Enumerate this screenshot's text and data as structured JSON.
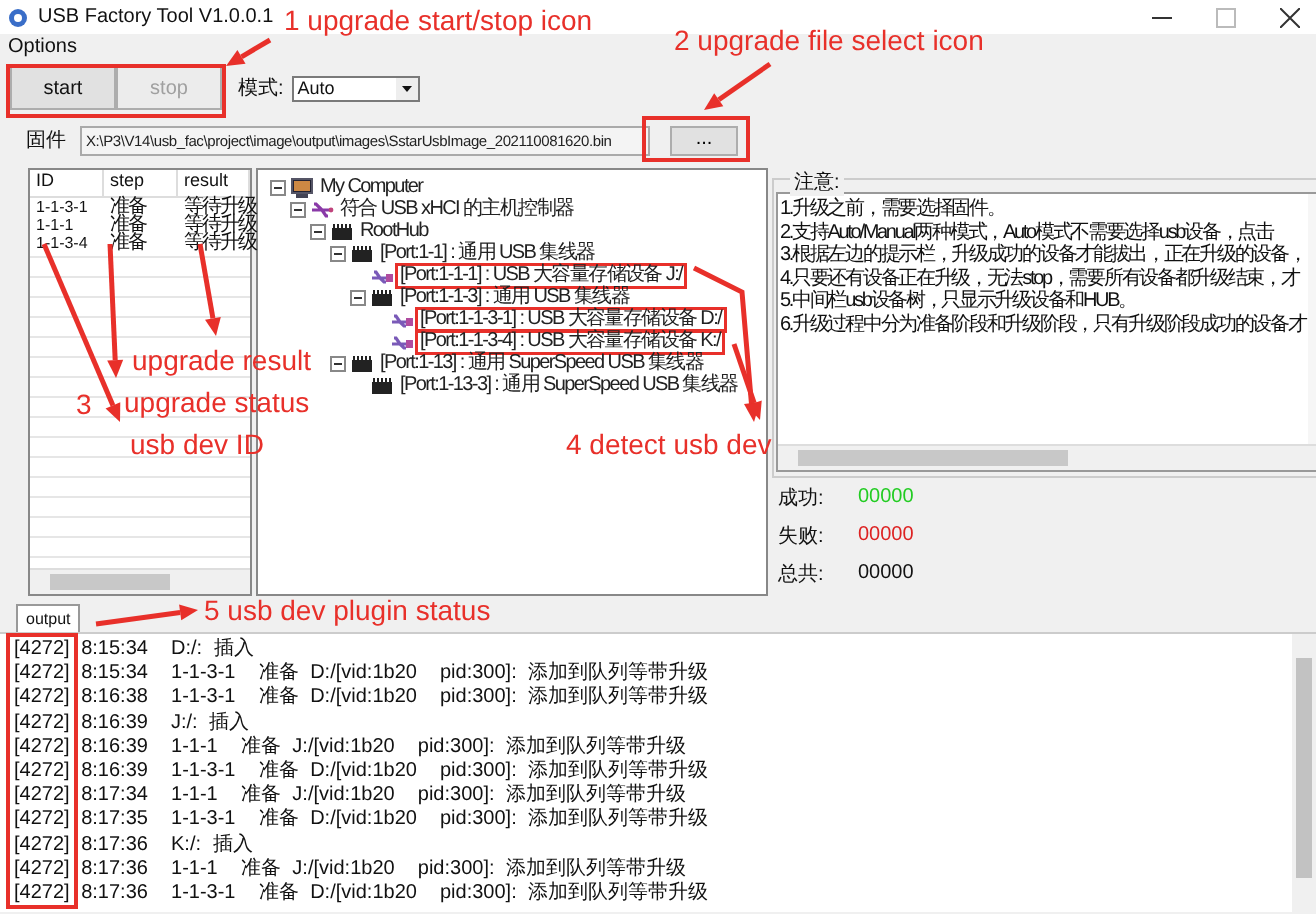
{
  "window": {
    "title": "USB Factory Tool V1.0.0.1"
  },
  "menu": [
    "Options"
  ],
  "buttons": [
    {
      "label": "start",
      "disabled": false
    },
    {
      "label": "stop",
      "disabled": true
    }
  ],
  "mode": {
    "label": "模式:",
    "value": "Auto"
  },
  "firmware": {
    "label": "固件",
    "value": "X:\\P3\\V14\\usb_fac\\project\\image\\output\\images\\SstarUsbImage_202110081620.bin",
    "button": "..."
  },
  "device_list": {
    "columns": [
      "ID",
      "step",
      "result"
    ],
    "rows": [
      [
        "1-1-3-1",
        "准备",
        "等待升级"
      ],
      [
        "1-1-1",
        "准备",
        "等待升级"
      ],
      [
        "1-1-3-4",
        "准备",
        "等待升级"
      ]
    ]
  },
  "tree": [
    {
      "label": "My Computer",
      "kind": "computer",
      "marked": false,
      "expanded": true,
      "children": [
        {
          "label": "符合 USB xHCI 的主机控制器",
          "kind": "controller",
          "marked": false,
          "expanded": true,
          "children": [
            {
              "label": "RootHub",
              "kind": "hub",
              "marked": false,
              "expanded": true,
              "children": [
                {
                  "label": "[Port:1-1] : 通用 USB 集线器",
                  "kind": "hub",
                  "marked": false,
                  "expanded": true,
                  "children": [
                    {
                      "label": "[Port:1-1-1] : USB 大容量存储设备 J:/",
                      "kind": "device",
                      "marked": true
                    },
                    {
                      "label": "[Port:1-1-3] : 通用 USB 集线器",
                      "kind": "hub",
                      "marked": false,
                      "expanded": true,
                      "children": [
                        {
                          "label": "[Port:1-1-3-1] : USB 大容量存储设备 D:/",
                          "kind": "device",
                          "marked": true
                        },
                        {
                          "label": "[Port:1-1-3-4] : USB 大容量存储设备 K:/",
                          "kind": "device",
                          "marked": true
                        }
                      ]
                    }
                  ]
                },
                {
                  "label": "[Port:1-13] : 通用 SuperSpeed USB 集线器",
                  "kind": "hub",
                  "marked": false,
                  "expanded": true,
                  "children": [
                    {
                      "label": "[Port:1-13-3] : 通用 SuperSpeed USB 集线器",
                      "kind": "hub",
                      "marked": false
                    }
                  ]
                }
              ]
            }
          ]
        }
      ]
    }
  ],
  "notes": {
    "title": "注意:",
    "lines": [
      "1.升级之前，需要选择固件。",
      "2.支持Auto/Manual两种模式，Auto模式不需要选择usb设备，点击",
      "3.根据左边的提示栏，升级成功的设备才能拔出，正在升级的设备，",
      "4.只要还有设备正在升级，无法stop，需要所有设备都升级结束，才",
      "5.中间栏usb设备树，只显示升级设备和HUB。",
      "6.升级过程中分为准备阶段和升级阶段，只有升级阶段成功的设备才"
    ]
  },
  "counters": [
    {
      "label": "成功:",
      "value": "00000",
      "color": "#22cc22"
    },
    {
      "label": "失败:",
      "value": "00000",
      "color": "#dd2222"
    },
    {
      "label": "总共:",
      "value": "00000",
      "color": "#111111"
    }
  ],
  "output_tab": {
    "label": "output",
    "selected": true
  },
  "log": [
    "[4272] 8:15:34  D:/: 插入",
    "[4272] 8:15:34  1-1-3-1  准备 D:/[vid:1b20  pid:300]: 添加到队列等带升级",
    "[4272] 8:16:38  1-1-3-1  准备 D:/[vid:1b20  pid:300]: 添加到队列等带升级",
    "[4272] 8:16:39  J:/: 插入",
    "[4272] 8:16:39  1-1-1  准备 J:/[vid:1b20  pid:300]: 添加到队列等带升级",
    "[4272] 8:16:39  1-1-3-1  准备 D:/[vid:1b20  pid:300]: 添加到队列等带升级",
    "[4272] 8:17:34  1-1-1  准备 J:/[vid:1b20  pid:300]: 添加到队列等带升级",
    "[4272] 8:17:35  1-1-3-1  准备 D:/[vid:1b20  pid:300]: 添加到队列等带升级",
    "[4272] 8:17:36  K:/: 插入",
    "[4272] 8:17:36  1-1-1  准备 J:/[vid:1b20  pid:300]: 添加到队列等带升级",
    "[4272] 8:17:36  1-1-3-1  准备 D:/[vid:1b20  pid:300]: 添加到队列等带升级"
  ],
  "annotations": [
    {
      "text": "1 upgrade start/stop icon"
    },
    {
      "text": "2 upgrade file select icon"
    },
    {
      "text": "3"
    },
    {
      "text": "upgrade result"
    },
    {
      "text": "upgrade status"
    },
    {
      "text": "usb dev ID"
    },
    {
      "text": "4 detect usb dev"
    },
    {
      "text": "5 usb dev plugin status"
    }
  ]
}
